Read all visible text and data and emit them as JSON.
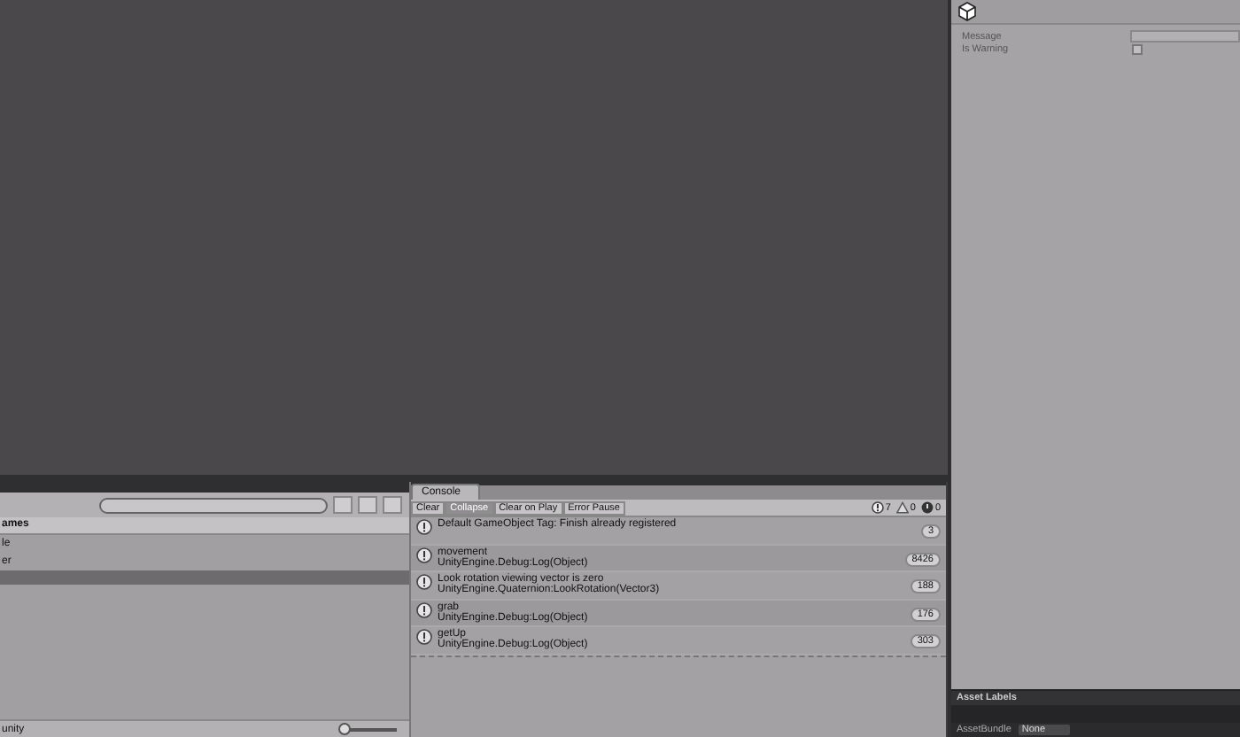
{
  "inspector": {
    "fields": [
      {
        "kind": "text",
        "label": "Message"
      },
      {
        "kind": "checkbox",
        "label": "Is Warning",
        "checked": false
      }
    ],
    "asset_labels": {
      "title": "Asset Labels",
      "bundle_label": "AssetBundle",
      "bundle_value": "None"
    }
  },
  "project": {
    "header": "ames",
    "items": [
      {
        "label": "le",
        "selected": false
      },
      {
        "label": "er",
        "selected": false
      },
      {
        "selected": true
      }
    ],
    "footer": "unity",
    "zoom": {
      "level": 0.05
    }
  },
  "console": {
    "tab": "Console",
    "buttons": [
      {
        "label": "Clear",
        "on": false
      },
      {
        "label": "Collapse",
        "on": true
      },
      {
        "label": "Clear on Play",
        "on": false
      },
      {
        "label": "Error Pause",
        "on": false
      }
    ],
    "counters": [
      {
        "kind": "info",
        "count": "7"
      },
      {
        "kind": "warning",
        "count": "0"
      },
      {
        "kind": "error",
        "count": "0"
      }
    ],
    "entries": [
      {
        "lines": [
          "Default GameObject Tag: Finish already registered"
        ],
        "count": "3"
      },
      {
        "lines": [
          "movement",
          "UnityEngine.Debug:Log(Object)"
        ],
        "count": "8426"
      },
      {
        "lines": [
          "Look rotation viewing vector is zero",
          "UnityEngine.Quaternion:LookRotation(Vector3)"
        ],
        "count": "188"
      },
      {
        "lines": [
          "grab",
          "UnityEngine.Debug:Log(Object)"
        ],
        "count": "176"
      },
      {
        "lines": [
          "getUp",
          "UnityEngine.Debug:Log(Object)"
        ],
        "count": "303"
      }
    ]
  }
}
